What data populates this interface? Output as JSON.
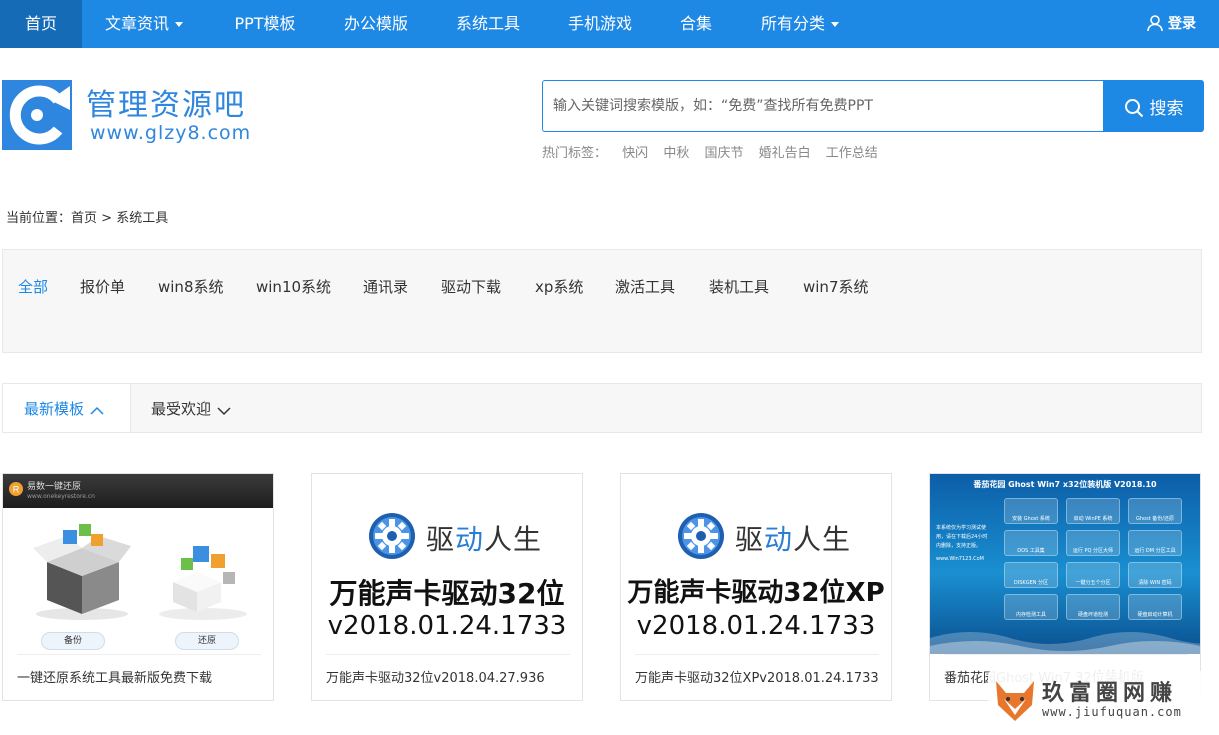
{
  "nav": {
    "items": [
      {
        "label": "首页",
        "active": true
      },
      {
        "label": "文章资讯",
        "dropdown": true
      },
      {
        "label": "PPT模板"
      },
      {
        "label": "办公模版"
      },
      {
        "label": "系统工具"
      },
      {
        "label": "手机游戏"
      },
      {
        "label": "合集"
      },
      {
        "label": "所有分类",
        "dropdown": true
      }
    ],
    "login_label": "登录"
  },
  "header": {
    "site_name": "管理资源吧",
    "site_url": "www.glzy8.com",
    "search": {
      "placeholder": "输入关键词搜索模版，如：“免费”查找所有免费PPT",
      "button_label": "搜索"
    },
    "hot_tags_label": "热门标签：",
    "hot_tags": [
      "快闪",
      "中秋",
      "国庆节",
      "婚礼告白",
      "工作总结"
    ]
  },
  "breadcrumb": {
    "prefix": "当前位置：",
    "home": "首页",
    "separator": ">",
    "current": "系统工具"
  },
  "categories": [
    "全部",
    "报价单",
    "win8系统",
    "win10系统",
    "通讯录",
    "驱动下载",
    "xp系统",
    "激活工具",
    "装机工具",
    "win7系统"
  ],
  "sort": {
    "newest": "最新模板",
    "popular": "最受欢迎"
  },
  "cards": [
    {
      "caption": "一键还原系统工具最新版免费下载",
      "thumb": {
        "app_title": "易数一键还原",
        "app_sub": "www.onekeyrestore.cn",
        "backup": "备份",
        "restore": "还原"
      }
    },
    {
      "caption": "万能声卡驱动32位v2018.04.27.936",
      "thumb": {
        "brand_a": "驱",
        "brand_b": "动",
        "brand_c": "人生",
        "line1": "万能声卡驱动32位",
        "line2": "v2018.01.24.1733"
      }
    },
    {
      "caption": "万能声卡驱动32位XPv2018.01.24.1733",
      "thumb": {
        "brand_a": "驱",
        "brand_b": "动",
        "brand_c": "人生",
        "line1": "万能声卡驱动32位XP",
        "line2": "v2018.01.24.1733"
      }
    },
    {
      "caption": "番茄花园Ghost Win7 32位装机版",
      "thumb": {
        "title": "番茄花园 Ghost Win7 x32位装机版 V2018.10",
        "side_text": "本系统仅为学习测试使用，请在下载后24小时内删除，支持正版。",
        "side_url": "www.Win7123.CoM",
        "tiles": [
          "安装 Ghost 系统",
          "启动 WinPE 系统",
          "Ghost 备份/还原",
          "DOS 工具集",
          "运行 PQ 分区大师",
          "运行 DM 分区工具",
          "DISKGEN 分区",
          "一键分五个分区",
          "清除 WIN 密码",
          "内存检测工具",
          "硬盘坏道检测",
          "硬盘启动计算机"
        ]
      }
    }
  ],
  "watermark": {
    "title": "玖富圈网赚",
    "url": "www.jiufuquan.com"
  },
  "colors": {
    "primary": "#1e88e5",
    "nav_active": "#166bb7",
    "panel_bg": "#f7f7f7"
  }
}
